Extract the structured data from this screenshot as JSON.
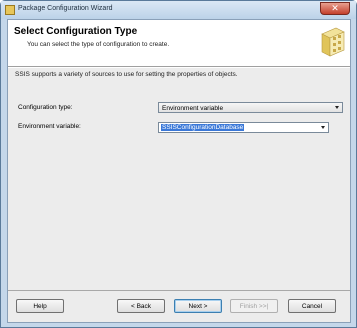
{
  "window": {
    "title": "Package Configuration Wizard",
    "close_glyph": "✕"
  },
  "header": {
    "title": "Select Configuration Type",
    "subtitle": "You can select the type of configuration to create."
  },
  "intro_text": "SSIS supports a variety of sources to use for setting the properties of objects.",
  "form": {
    "configuration_type_label": "Configuration type:",
    "configuration_type_value": "Environment variable",
    "environment_variable_label": "Environment variable:",
    "environment_variable_value": "SSISConfigurationDatabase"
  },
  "buttons": {
    "help": "Help",
    "back": "< Back",
    "next": "Next >",
    "finish": "Finish >>|",
    "cancel": "Cancel"
  },
  "icons": {
    "title_icon": "package-wizard-icon",
    "header_art": "configuration-wizard-art-icon"
  },
  "colors": {
    "selection_highlight": "#3a78d8",
    "window_frame": "#c4d7ea",
    "close_button": "#c4402c"
  }
}
